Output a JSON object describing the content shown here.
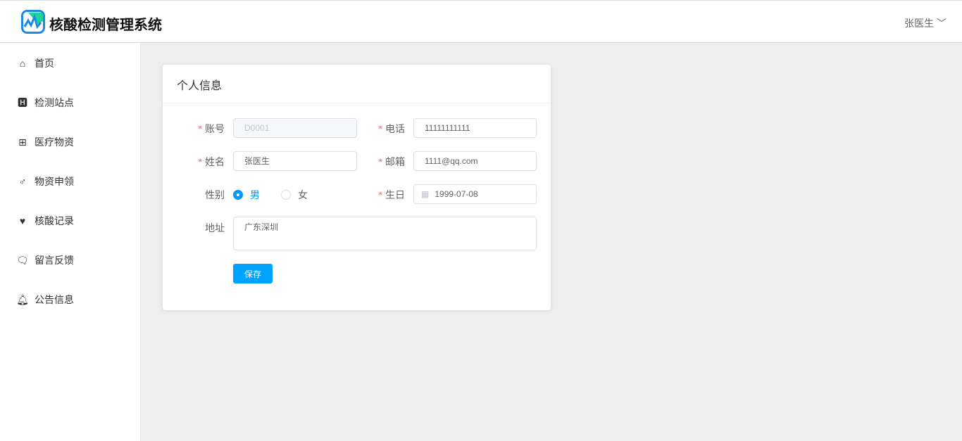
{
  "header": {
    "title": "核酸检测管理系统",
    "user": "张医生"
  },
  "sidebar": {
    "items": [
      {
        "label": "首页",
        "icon": "home-icon"
      },
      {
        "label": "检测站点",
        "icon": "hospital-icon"
      },
      {
        "label": "医疗物资",
        "icon": "medkit-icon"
      },
      {
        "label": "物资申领",
        "icon": "mars-icon"
      },
      {
        "label": "核酸记录",
        "icon": "heartbeat-icon"
      },
      {
        "label": "留言反馈",
        "icon": "comments-icon"
      },
      {
        "label": "公告信息",
        "icon": "bell-icon"
      }
    ]
  },
  "card": {
    "title": "个人信息"
  },
  "form": {
    "account": {
      "label": "账号",
      "value": "D0001"
    },
    "phone": {
      "label": "电话",
      "value": "11111111111"
    },
    "name": {
      "label": "姓名",
      "value": "张医生"
    },
    "email": {
      "label": "邮箱",
      "value": "1111@qq.com"
    },
    "gender": {
      "label": "性别",
      "options": [
        "男",
        "女"
      ],
      "selected": "男"
    },
    "birthday": {
      "label": "生日",
      "value": "1999-07-08"
    },
    "address": {
      "label": "地址",
      "value": "广东深圳"
    },
    "required_mark": "*",
    "save": "保存"
  }
}
